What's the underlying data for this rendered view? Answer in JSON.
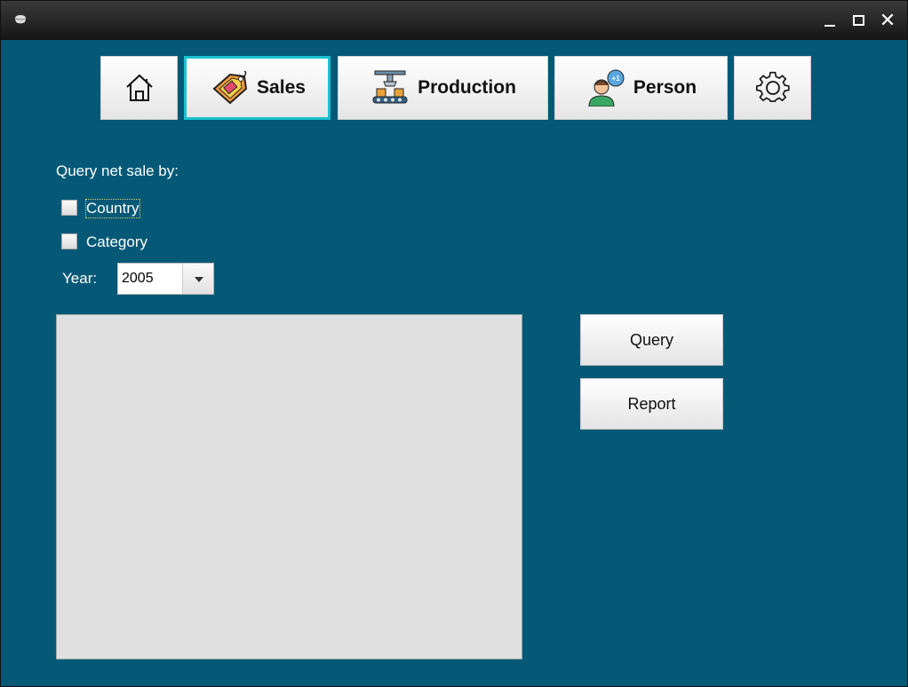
{
  "window": {
    "controls": {
      "minimize": "minimize-icon",
      "maximize": "maximize-icon",
      "close": "close-icon"
    }
  },
  "nav": {
    "home_icon": "home-icon",
    "sales_label": "Sales",
    "production_label": "Production",
    "person_label": "Person",
    "settings_icon": "gear-icon",
    "active": "Sales"
  },
  "form": {
    "query_label": "Query net sale by:",
    "country_label": "Country",
    "category_label": "Category",
    "year_label": "Year:",
    "year_value": "2005"
  },
  "actions": {
    "query_label": "Query",
    "report_label": "Report"
  },
  "colors": {
    "background": "#055977",
    "active_border": "#19c1cf",
    "panel": "#e0e0e0"
  }
}
